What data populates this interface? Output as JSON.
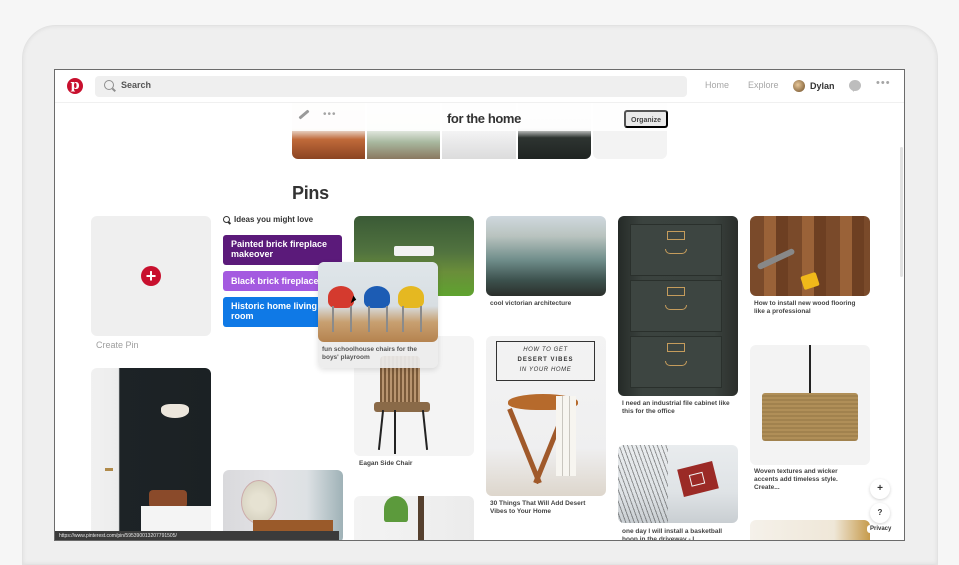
{
  "header": {
    "search_placeholder": "Search",
    "nav_home": "Home",
    "nav_explore": "Explore",
    "user_name": "Dylan",
    "more_label": "•••"
  },
  "board": {
    "title": "for the home",
    "more_label": "•••",
    "organize_label": "Organize"
  },
  "pins_section": {
    "title": "Pins",
    "create_pin_label": "Create Pin",
    "create_pin_icon": "+",
    "ideas_heading": "Ideas you might love",
    "idea_chips": [
      {
        "label": "Painted brick fireplace makeover",
        "color": "#5b1a7a"
      },
      {
        "label": "Black brick fireplace",
        "color": "#a45ae0"
      },
      {
        "label": "Historic home living room",
        "color": "#0f79e6"
      }
    ]
  },
  "pins": [
    {
      "id": "drone",
      "caption": ""
    },
    {
      "id": "victorian",
      "caption": "cool victorian architecture"
    },
    {
      "id": "wicker-chair",
      "caption": "Eagan Side Chair"
    },
    {
      "id": "desert",
      "caption": "30 Things That Will Add Desert Vibes to Your Home",
      "overlay_lines": [
        "HOW TO GET",
        "DESERT VIBES",
        "IN YOUR HOME"
      ]
    },
    {
      "id": "cabinet",
      "caption": "I need an industrial file cabinet like this for the office"
    },
    {
      "id": "flooring",
      "caption": "How to install new wood flooring like a professional"
    },
    {
      "id": "lamp",
      "caption": "Woven textures and wicker accents add timeless style. Create..."
    },
    {
      "id": "hoop",
      "caption": "one day I will install a basketball hoop in the driveway - I"
    },
    {
      "id": "entry",
      "caption": ""
    },
    {
      "id": "fan",
      "caption": ""
    },
    {
      "id": "plant",
      "caption": ""
    },
    {
      "id": "sunburst",
      "caption": ""
    }
  ],
  "dragging_pin": {
    "caption": "fun schoolhouse chairs for the boys' playroom"
  },
  "floating": {
    "add_label": "+",
    "help_label": "?",
    "privacy_label": "Privacy"
  },
  "statusbar": {
    "url": "https://www.pinterest.com/pin/595390013207791505/"
  },
  "colors": {
    "brand": "#c8102e"
  }
}
